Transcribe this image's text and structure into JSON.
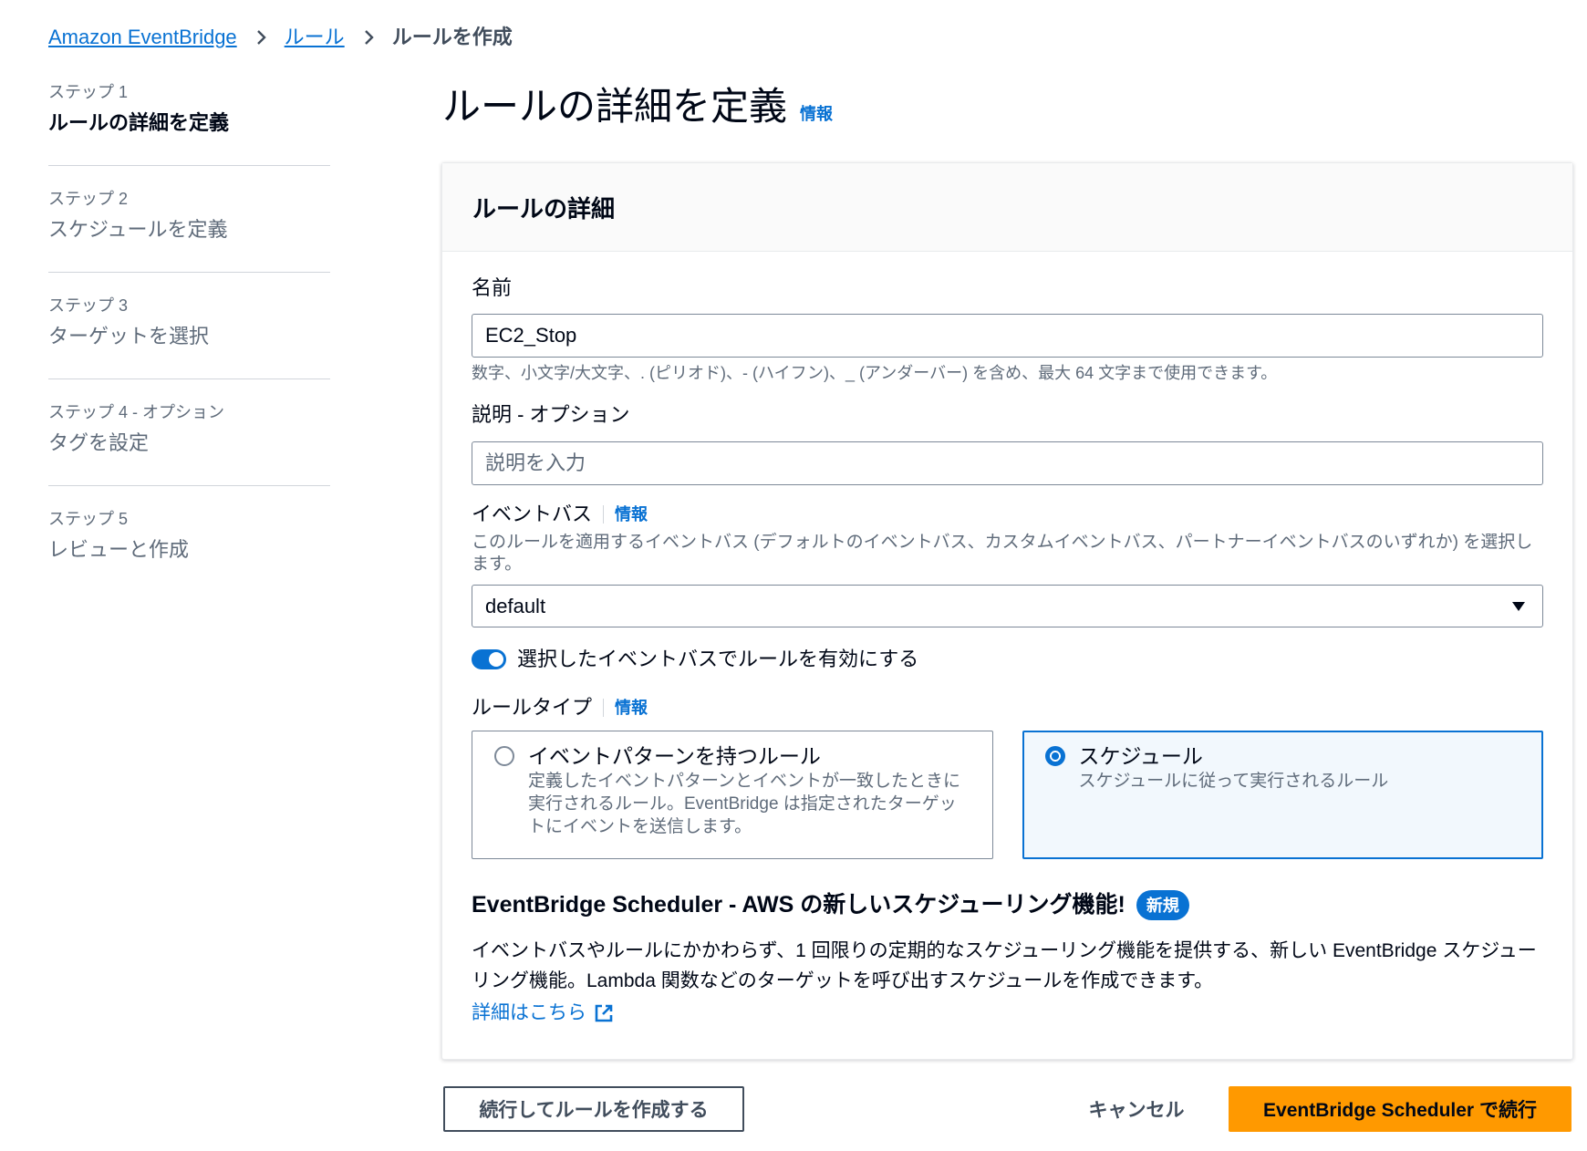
{
  "colors": {
    "accent": "#0972d3",
    "primary_button": "#ff9900",
    "selected_tile_bg": "#f2f8fd",
    "text": "#000716",
    "secondary_text": "#5f6b7a"
  },
  "icons": {
    "breadcrumb_separator": "chevron-right-icon",
    "select_caret": "caret-down-icon",
    "external_link": "external-link-icon"
  },
  "breadcrumb": {
    "items": [
      {
        "label": "Amazon EventBridge",
        "link": true
      },
      {
        "label": "ルール",
        "link": true
      },
      {
        "label": "ルールを作成",
        "link": false
      }
    ]
  },
  "nav": {
    "steps": [
      {
        "caption": "ステップ 1",
        "label": "ルールの詳細を定義",
        "active": true
      },
      {
        "caption": "ステップ 2",
        "label": "スケジュールを定義",
        "active": false
      },
      {
        "caption": "ステップ 3",
        "label": "ターゲットを選択",
        "active": false
      },
      {
        "caption": "ステップ 4 - オプション",
        "label": "タグを設定",
        "active": false
      },
      {
        "caption": "ステップ 5",
        "label": "レビューと作成",
        "active": false
      }
    ]
  },
  "page": {
    "title": "ルールの詳細を定義",
    "info": "情報"
  },
  "panel": {
    "title": "ルールの詳細",
    "name": {
      "label": "名前",
      "value": "EC2_Stop",
      "hint": "数字、小文字/大文字、. (ピリオド)、- (ハイフン)、_ (アンダーバー) を含め、最大 64 文字まで使用できます。"
    },
    "description": {
      "label": "説明 - オプション",
      "placeholder": "説明を入力"
    },
    "event_bus": {
      "label": "イベントバス",
      "info": "情報",
      "description": "このルールを適用するイベントバス (デフォルトのイベントバス、カスタムイベントバス、パートナーイベントバスのいずれか) を選択します。",
      "value": "default"
    },
    "enable_toggle": {
      "label": "選択したイベントバスでルールを有効にする",
      "on": true
    },
    "rule_type": {
      "label": "ルールタイプ",
      "info": "情報",
      "options": [
        {
          "title": "イベントパターンを持つルール",
          "description": "定義したイベントパターンとイベントが一致したときに実行されるルール。EventBridge は指定されたターゲットにイベントを送信します。",
          "selected": false
        },
        {
          "title": "スケジュール",
          "description": "スケジュールに従って実行されるルール",
          "selected": true
        }
      ]
    },
    "scheduler": {
      "heading": "EventBridge Scheduler - AWS の新しいスケジューリング機能!",
      "badge": "新規",
      "body": "イベントバスやルールにかかわらず、1 回限りの定期的なスケジューリング機能を提供する、新しい EventBridge スケジューリング機能。Lambda 関数などのターゲットを呼び出すスケジュールを作成できます。",
      "link": "詳細はこちら"
    }
  },
  "footer": {
    "create_rule": "続行してルールを作成する",
    "cancel": "キャンセル",
    "continue_scheduler": "EventBridge Scheduler で続行"
  }
}
